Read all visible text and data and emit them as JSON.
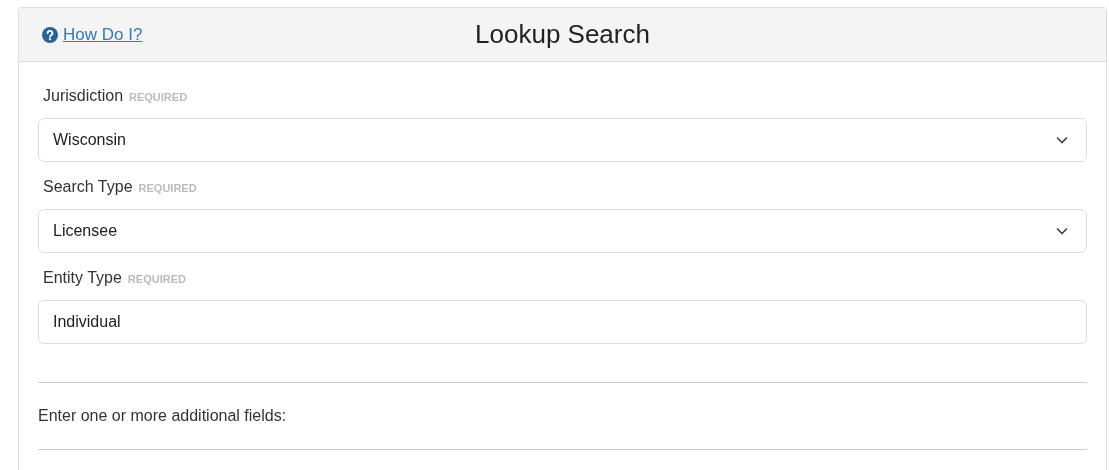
{
  "header": {
    "help_link": "How Do I?",
    "title": "Lookup Search"
  },
  "fields": [
    {
      "label": "Jurisdiction",
      "badge": "REQUIRED",
      "kind": "select",
      "value": "Wisconsin"
    },
    {
      "label": "Search Type",
      "badge": "REQUIRED",
      "kind": "select",
      "value": "Licensee"
    },
    {
      "label": "Entity Type",
      "badge": "REQUIRED",
      "kind": "text",
      "value": "Individual"
    }
  ],
  "instruction": "Enter one or more additional fields:"
}
